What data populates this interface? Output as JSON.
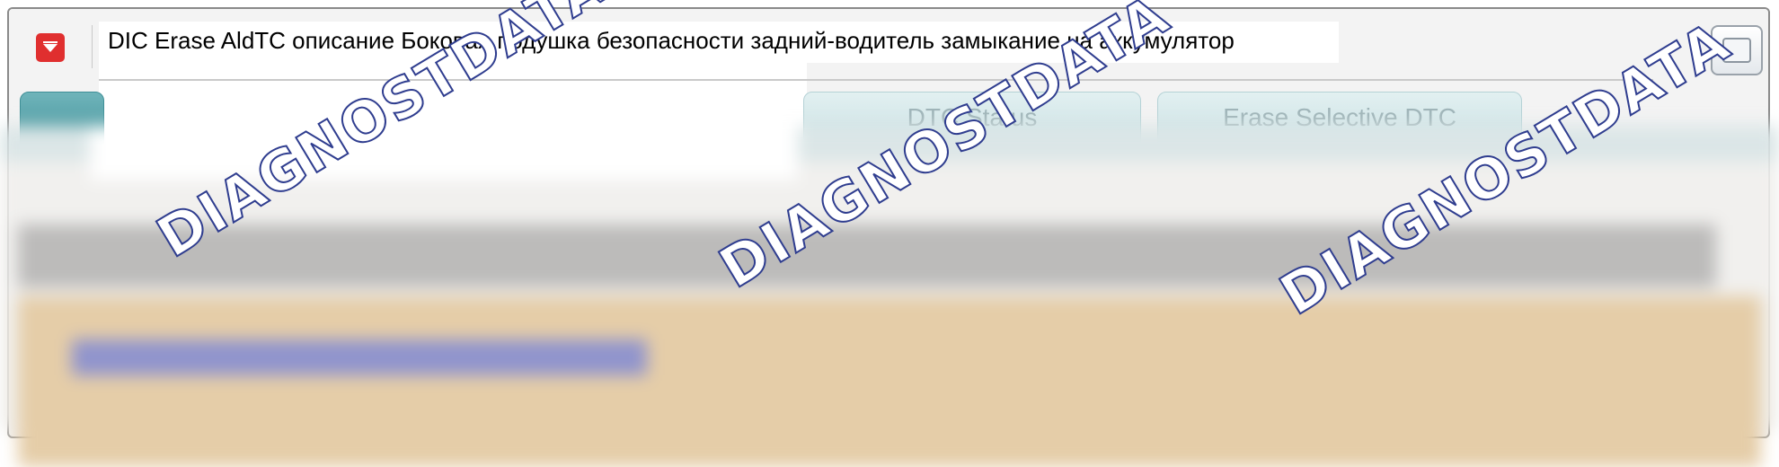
{
  "window": {
    "title": "DIC Erase AldTC описание Боковая подушка безопасности задний-водитель замыкание на аккумулятор"
  },
  "icons": {
    "menu": "chevron-down-icon",
    "restore": "window-restore-icon"
  },
  "tabs": [
    {
      "label": ""
    },
    {
      "label": "DTC Status"
    },
    {
      "label": "Erase Selective DTC"
    }
  ],
  "watermark": {
    "text": "DIAGNOSTDATA"
  },
  "colors": {
    "accent_red": "#e02f2f",
    "tab_active": "#3f8f97",
    "tab_inactive": "#c7dfe2",
    "panel_beige": "#e5cda8",
    "watermark_outline": "#2f3d8f"
  }
}
